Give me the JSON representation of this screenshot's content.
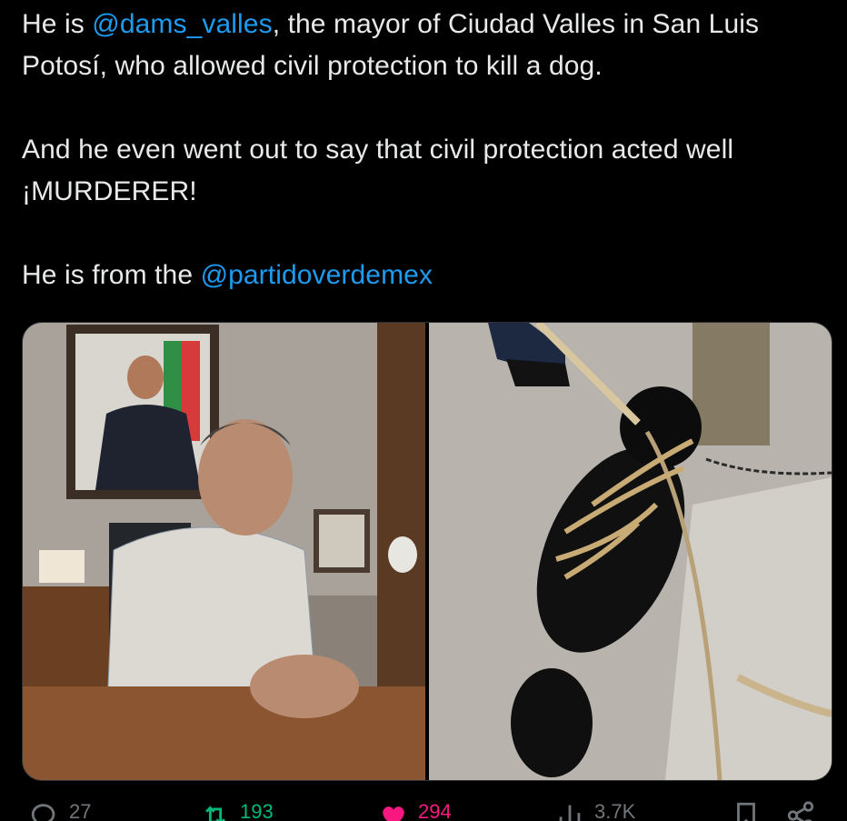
{
  "tweet": {
    "line1_before": "He is ",
    "mention1": "@dams_valles",
    "line1_after": ", the mayor of Ciudad Valles in San Luis Potosí, who allowed civil protection to kill a dog.",
    "para2": "And he even went out to say that civil protection acted well ¡MURDERER!",
    "para3_before": "He is from the ",
    "mention2": "@partidoverdemex"
  },
  "media": [
    {
      "icon": "photo-mayor-office"
    },
    {
      "icon": "photo-tied-dog"
    }
  ],
  "actions": {
    "replies": "27",
    "reposts": "193",
    "likes": "294",
    "views": "3.7K"
  },
  "colors": {
    "background": "#000000",
    "text": "#e7e9ea",
    "link": "#1d9bf0",
    "muted": "#71767b",
    "repost": "#00ba7c",
    "like": "#f91880"
  }
}
